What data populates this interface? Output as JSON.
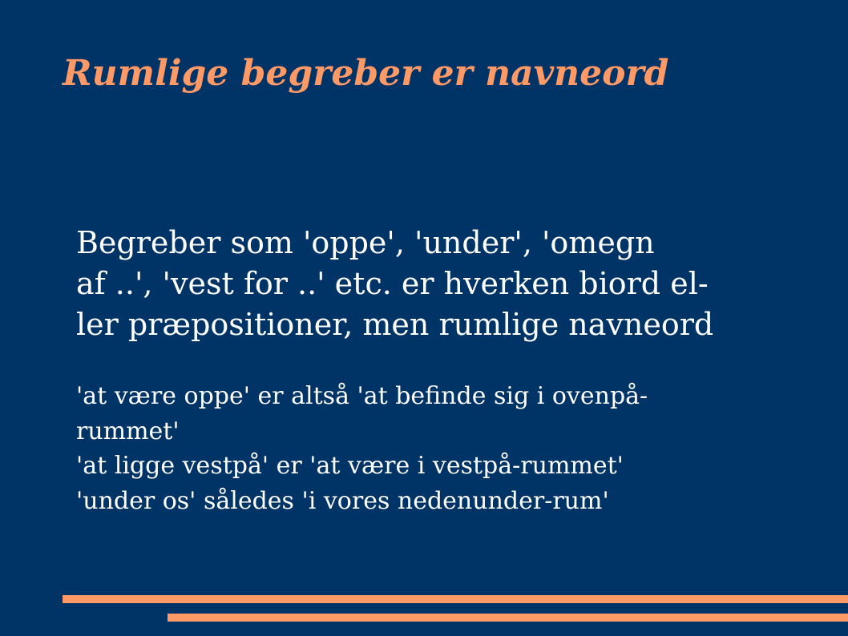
{
  "slide": {
    "title": "Rumlige begreber er navneord",
    "paragraph1": [
      "Begreber som 'oppe', 'under', 'omegn",
      "af ..', 'vest for ..' etc. er hverken biord el-",
      "ler præpositioner, men rumlige navneord"
    ],
    "paragraph2": [
      "'at være oppe' er altså 'at befinde sig i ovenpå-",
      "rummet'",
      "'at ligge vestpå' er 'at være i vestpå-rummet'",
      "'under os' således 'i vores nedenunder-rum'"
    ]
  },
  "colors": {
    "background": "#003366",
    "accent": "#ff9966",
    "text": "#ffffff"
  }
}
